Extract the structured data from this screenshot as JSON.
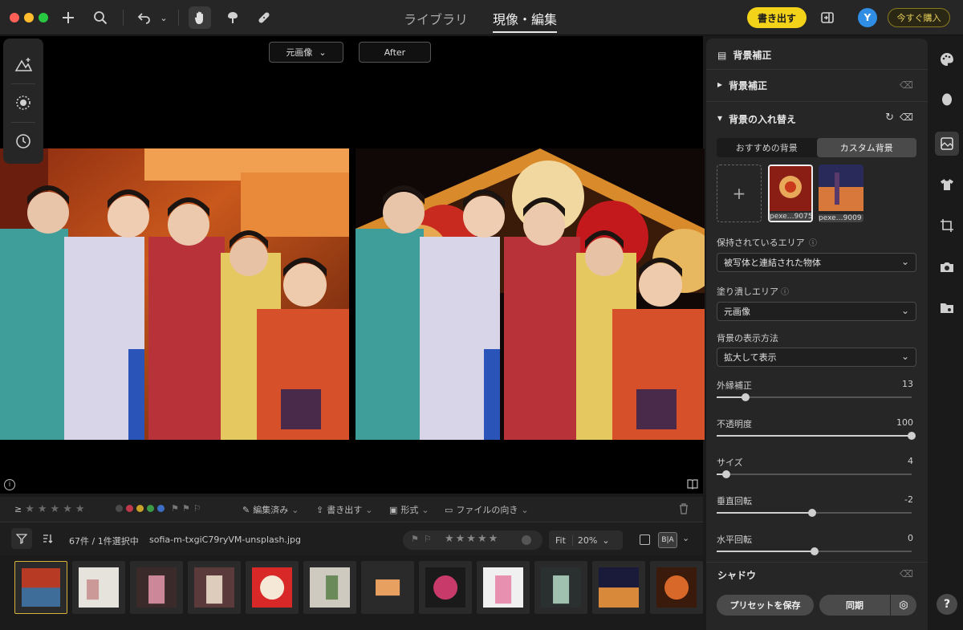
{
  "topbar": {
    "tabs": [
      {
        "label": "ライブラリ",
        "active": false
      },
      {
        "label": "現像・編集",
        "active": true
      }
    ],
    "export_label": "書き出す",
    "avatar_letter": "Y",
    "buy_label": "今すぐ購入",
    "icons": [
      "plus-icon",
      "search-icon",
      "undo-icon",
      "hand-icon",
      "brush-icon",
      "bandage-icon",
      "sidebar-toggle-icon"
    ]
  },
  "canvas": {
    "compare_select": "元画像",
    "after_label": "After"
  },
  "filterbar": {
    "rating_prefix": "≥",
    "edited_label": "編集済み",
    "exported_label": "書き出す",
    "format_label": "形式",
    "orientation_label": "ファイルの向き",
    "color_labels": [
      "#4a4a4a",
      "#c0394a",
      "#c9a227",
      "#3a9a45",
      "#3c6fc4"
    ]
  },
  "filmstrip": {
    "count_text": "67件 / 1件選択中",
    "filename": "sofia-m-txgiC79ryVM-unsplash.jpg",
    "zoom_fit": "Fit",
    "zoom_percent": "20%",
    "view_mode": "B|A"
  },
  "panel": {
    "header_title": "背景補正",
    "section1_title": "背景補正",
    "section2_title": "背景の入れ替え",
    "seg_options": [
      "おすすめの背景",
      "カスタム背景"
    ],
    "seg_active": 1,
    "bg_thumbs": [
      "pexe…9075",
      "pexe…9009"
    ],
    "keep_area_label": "保持されているエリア",
    "keep_area_value": "被写体と連結された物体",
    "fill_area_label": "塗り潰しエリア",
    "fill_area_value": "元画像",
    "display_label": "背景の表示方法",
    "display_value": "拡大して表示",
    "sliders": [
      {
        "label": "外縁補正",
        "value": "13",
        "pos": 0.15
      },
      {
        "label": "不透明度",
        "value": "100",
        "pos": 1.0
      },
      {
        "label": "サイズ",
        "value": "4",
        "pos": 0.05
      },
      {
        "label": "垂直回転",
        "value": "-2",
        "pos": 0.49
      },
      {
        "label": "水平回転",
        "value": "0",
        "pos": 0.5
      }
    ],
    "shadow_title": "シャドウ",
    "save_preset_label": "プリセットを保存",
    "sync_label": "同期"
  },
  "right_icons": [
    "palette-icon",
    "face-icon",
    "background-icon",
    "shirt-icon",
    "crop-icon",
    "camera-icon",
    "folder-eye-icon",
    "help-icon"
  ],
  "help_glyph": "?"
}
